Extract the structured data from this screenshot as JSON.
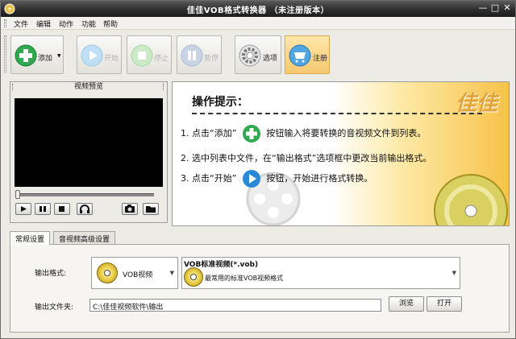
{
  "window": {
    "title": "佳佳VOB格式转换器  （未注册版本）",
    "controls": {
      "minimize": "—",
      "maximize": "□",
      "close": "✕"
    }
  },
  "menu": [
    "文件",
    "编辑",
    "动作",
    "功能",
    "帮助"
  ],
  "toolbar": {
    "add_label": "添加",
    "start_label": "开始",
    "stop_label": "停止",
    "pause_label": "暂停",
    "options_label": "选项",
    "register_label": "注册"
  },
  "preview": {
    "title": "视频预览",
    "seek_position": 0
  },
  "tips": {
    "title": "操作提示：",
    "brand": "佳佳",
    "steps": [
      {
        "pre": "1. 点击“添加”",
        "post": "按钮输入将要转换的音视频文件到列表。"
      },
      {
        "pre": "2. 选中列表中文件，在“输出格式”选项框中更改当前输出格式。",
        "post": ""
      },
      {
        "pre": "3. 点击“开始”",
        "post": "按钮，开始进行格式转换。"
      }
    ]
  },
  "tabs": [
    "常规设置",
    "音视频高级设置"
  ],
  "settings": {
    "output_format_label": "输出格式:",
    "format_type": "VOB视频",
    "format_name": "VOB标准视频(*.vob)",
    "format_desc": "最常用的标准VOB视频格式",
    "output_folder_label": "输出文件夹:",
    "output_folder_value": "C:\\佳佳视频软件\\输出",
    "browse_label": "浏览",
    "open_label": "打开"
  },
  "colors": {
    "accent_orange": "#f7c24a",
    "green": "#2fa84f",
    "blue": "#2a88d8"
  }
}
